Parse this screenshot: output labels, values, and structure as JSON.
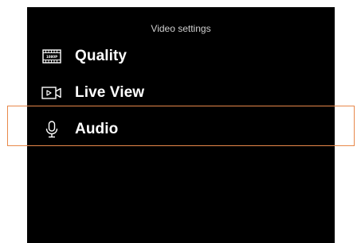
{
  "header": {
    "title": "Video settings"
  },
  "menu": {
    "items": [
      {
        "label": "Quality",
        "icon": "film-1080p-icon",
        "icon_text": "1080P"
      },
      {
        "label": "Live View",
        "icon": "video-play-icon"
      },
      {
        "label": "Audio",
        "icon": "microphone-icon"
      }
    ]
  },
  "colors": {
    "background": "#000000",
    "text": "#ffffff",
    "title_text": "#cfcfcf",
    "highlight": "#e8884a"
  }
}
